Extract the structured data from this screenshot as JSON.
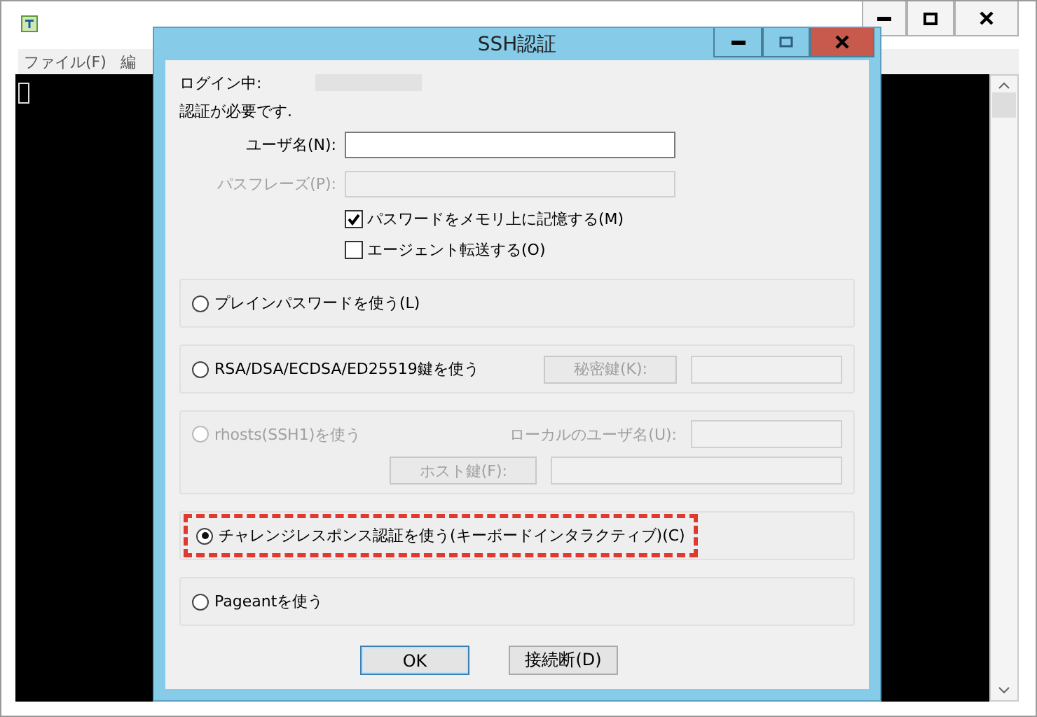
{
  "terminal_window": {
    "menu": [
      "ファイル(F)",
      "編"
    ]
  },
  "dialog": {
    "title": "SSH認証",
    "login_label": "ログイン中:",
    "message": "認証が必要です.",
    "fields": [
      {
        "label": "ユーザ名(N):",
        "disabled": false
      },
      {
        "label": "パスフレーズ(P):",
        "disabled": true
      }
    ],
    "checkboxes": [
      {
        "label": "パスワードをメモリ上に記憶する(M)",
        "checked": true
      },
      {
        "label": "エージェント転送する(O)",
        "checked": false
      }
    ],
    "methods": [
      {
        "label": "プレインパスワードを使う(L)",
        "selected": false,
        "disabled": false,
        "highlighted": false
      },
      {
        "label": "RSA/DSA/ECDSA/ED25519鍵を使う",
        "selected": false,
        "disabled": false,
        "highlighted": false,
        "rows": [
          [
            {
              "kind": "button",
              "label": "秘密鍵(K):"
            },
            {
              "kind": "field"
            }
          ]
        ]
      },
      {
        "label": "rhosts(SSH1)を使う",
        "selected": false,
        "disabled": true,
        "highlighted": false,
        "rows": [
          [
            {
              "kind": "label",
              "label": "ローカルのユーザ名(U):"
            },
            {
              "kind": "field"
            }
          ],
          [
            {
              "kind": "button",
              "label": "ホスト鍵(F):"
            },
            {
              "kind": "field"
            }
          ]
        ]
      },
      {
        "label": "チャレンジレスポンス認証を使う(キーボードインタラクティブ)(C)",
        "selected": true,
        "disabled": false,
        "highlighted": true
      },
      {
        "label": "Pageantを使う",
        "selected": false,
        "disabled": false,
        "highlighted": false
      }
    ],
    "buttons": [
      {
        "label": "OK",
        "default": true
      },
      {
        "label": "接続断(D)",
        "default": false
      }
    ]
  }
}
